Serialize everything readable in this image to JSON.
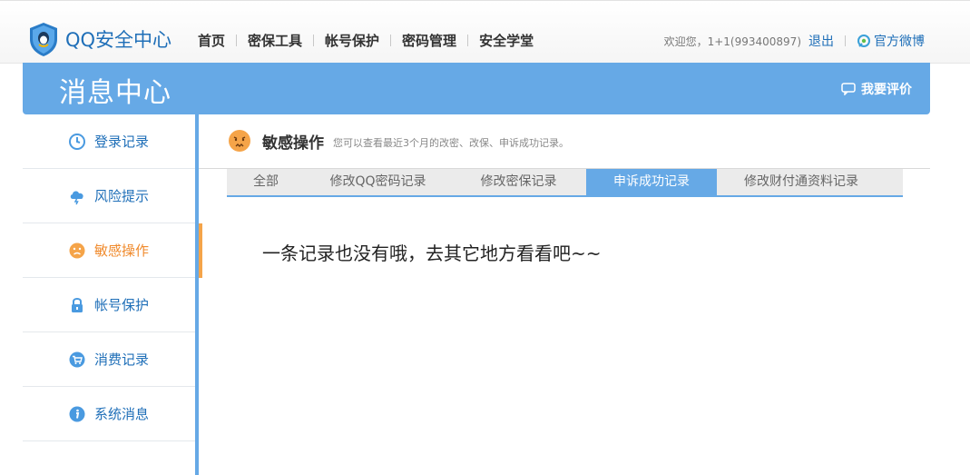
{
  "header": {
    "logo_text": "QQ安全中心",
    "nav": [
      "首页",
      "密保工具",
      "帐号保护",
      "密码管理",
      "安全学堂"
    ],
    "welcome": "欢迎您，1+1(993400897)",
    "logout": "退出",
    "weibo": "官方微博"
  },
  "banner": {
    "title": "消息中心",
    "rate_label": "我要评价"
  },
  "sidebar": {
    "items": [
      {
        "label": "登录记录",
        "icon": "clock-icon"
      },
      {
        "label": "风险提示",
        "icon": "cloud-lightning-icon"
      },
      {
        "label": "敏感操作",
        "icon": "face-icon",
        "active": true
      },
      {
        "label": "帐号保护",
        "icon": "lock-icon"
      },
      {
        "label": "消费记录",
        "icon": "cart-icon"
      },
      {
        "label": "系统消息",
        "icon": "info-icon"
      }
    ]
  },
  "main": {
    "title": "敏感操作",
    "description": "您可以查看最近3个月的改密、改保、申诉成功记录。",
    "tabs": [
      "全部",
      "修改QQ密码记录",
      "修改密保记录",
      "申诉成功记录",
      "修改财付通资料记录"
    ],
    "active_tab": "申诉成功记录",
    "empty_message": "一条记录也没有哦，去其它地方看看吧~~"
  },
  "colors": {
    "accent_blue": "#66a9e6",
    "link_blue": "#1f6fb8",
    "active_orange": "#f08a2c"
  }
}
